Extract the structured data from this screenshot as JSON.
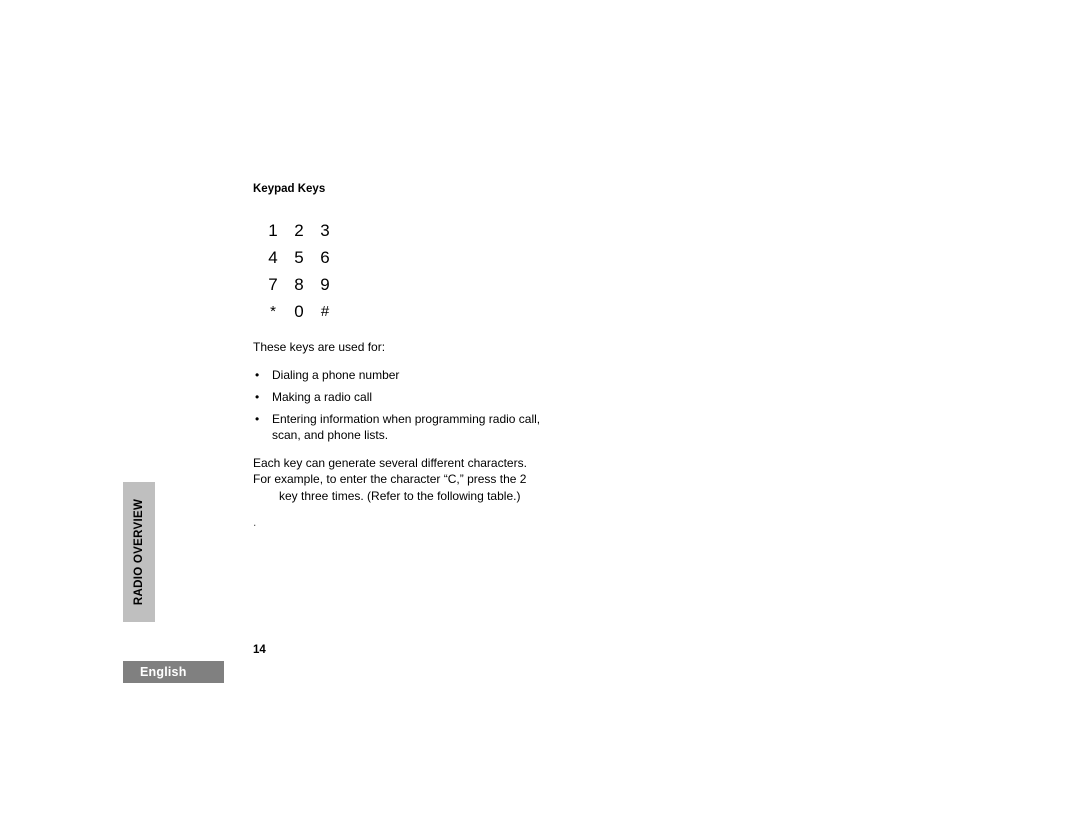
{
  "document": {
    "chapter_tab_label": "RADIO OVERVIEW",
    "language_tab_label": "English",
    "page_number": "14",
    "colors": {
      "chapter_tab_bg": "#bfbfbf",
      "language_tab_bg": "#808080",
      "language_tab_text": "#ffffff",
      "body_text": "#000000",
      "page_bg": "#ffffff"
    }
  },
  "section": {
    "heading": "Keypad Keys",
    "keypad": {
      "keys": [
        "1",
        "2",
        "3",
        "4",
        "5",
        "6",
        "7",
        "8",
        "9",
        "*",
        "0",
        "#"
      ],
      "rows": 4,
      "columns": 3
    },
    "intro": "These keys are used for:",
    "bullets": [
      {
        "marker": "•",
        "text": "Dialing a phone number"
      },
      {
        "marker": "•",
        "text": "Making a radio call"
      },
      {
        "marker": "•",
        "text": "Entering information when programming radio call, scan, and phone lists."
      }
    ],
    "paragraph": {
      "before_glyph": "Each key can generate several different characters. For example, to enter the character “C,” press the 2",
      "after_glyph": "key three times. (Refer to the following table.)"
    },
    "stray_mark": "."
  }
}
